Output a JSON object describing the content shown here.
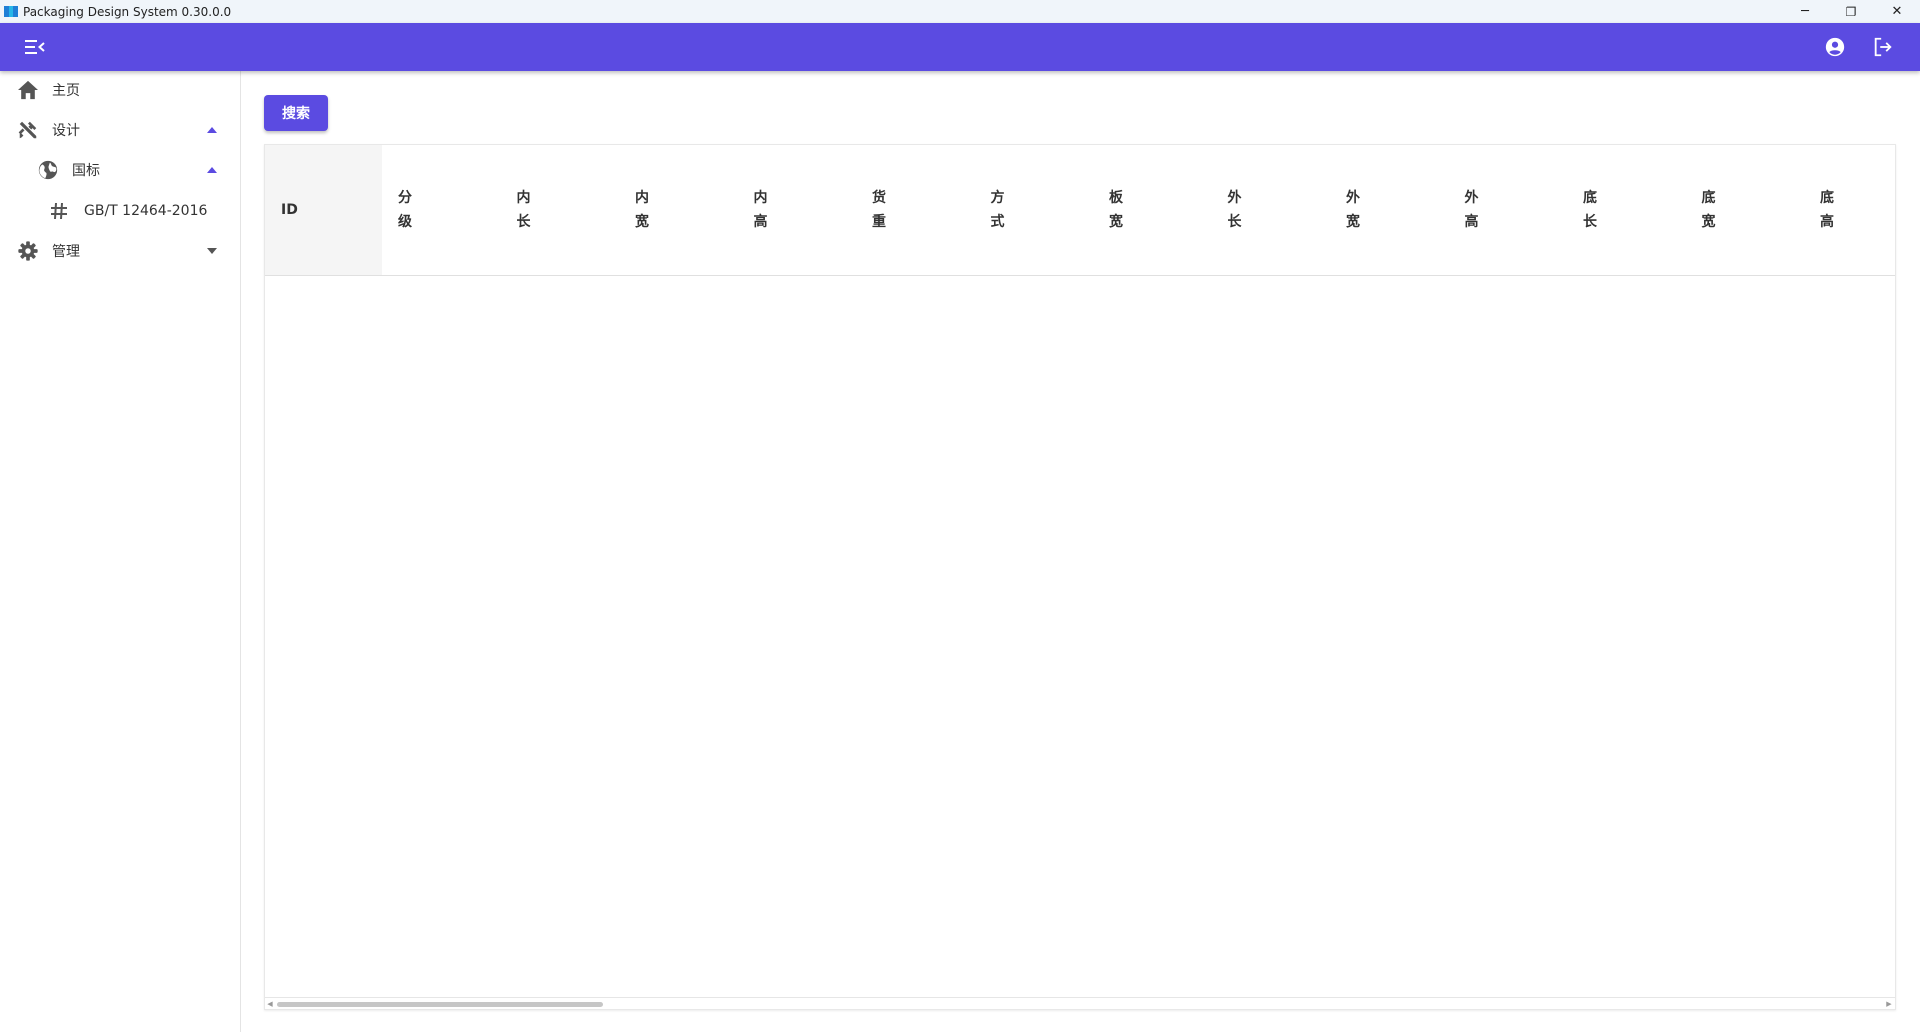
{
  "window": {
    "title": "Packaging Design System 0.30.0.0",
    "minimize": "─",
    "restore": "❐",
    "close": "✕"
  },
  "theme": {
    "primary": "#5b4be1",
    "icon_gray": "#555555"
  },
  "toolbar": {
    "menu_icon": "menu-collapse-icon",
    "account_icon": "account-circle-icon",
    "logout_icon": "logout-icon"
  },
  "sidebar": {
    "items": [
      {
        "label": "主页",
        "icon": "home-icon"
      },
      {
        "label": "设计",
        "icon": "design-tools-icon",
        "expanded": true
      },
      {
        "label": "国标",
        "icon": "globe-icon",
        "expanded": true
      },
      {
        "label": "GB/T 12464-2016",
        "icon": "hash-icon"
      },
      {
        "label": "管理",
        "icon": "gear-icon",
        "expanded": false
      }
    ]
  },
  "main": {
    "search_label": "搜索",
    "columns": [
      "ID",
      "分级",
      "内长",
      "内宽",
      "内高",
      "货重",
      "方式",
      "板宽",
      "外长",
      "外宽",
      "外高",
      "底长",
      "底宽",
      "底高"
    ]
  }
}
